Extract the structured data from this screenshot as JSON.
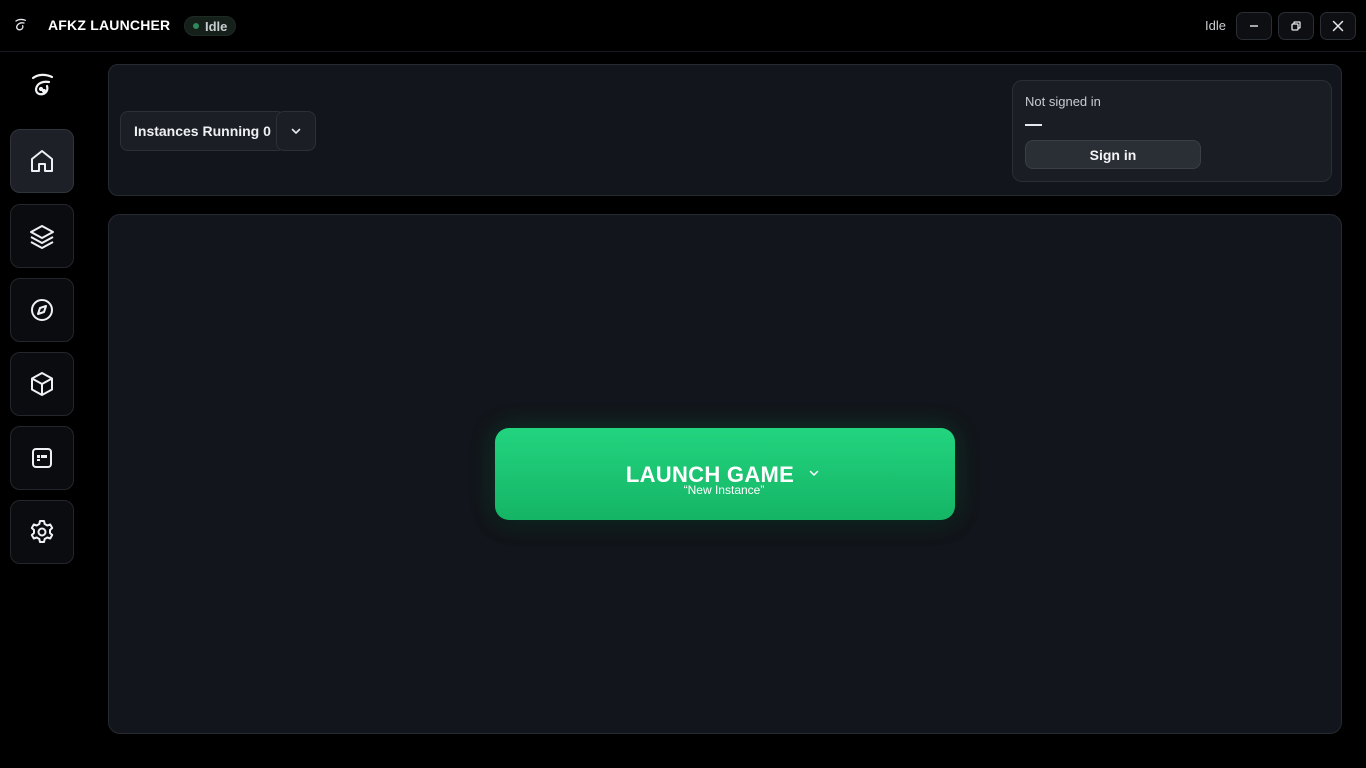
{
  "titlebar": {
    "app_title": "AFKZ LAUNCHER",
    "badge": "Idle",
    "status": "Idle",
    "logo_icon": "afkz-logo-icon",
    "controls": [
      "minimize-icon",
      "restore-icon",
      "close-icon"
    ]
  },
  "sidebar": {
    "logo_icon": "afkz-logo-icon",
    "items": [
      {
        "name": "home",
        "icon": "home-icon",
        "active": true
      },
      {
        "name": "layers",
        "icon": "layers-icon",
        "active": false
      },
      {
        "name": "discover",
        "icon": "compass-icon",
        "active": false
      },
      {
        "name": "packages",
        "icon": "cube-icon",
        "active": false
      },
      {
        "name": "dashboard",
        "icon": "app-window-icon",
        "active": false
      },
      {
        "name": "settings",
        "icon": "gear-icon",
        "active": false
      }
    ]
  },
  "instances": {
    "label": "Instances Running 0"
  },
  "account": {
    "status": "Not signed in",
    "sign_in_label": "Sign in"
  },
  "launch": {
    "title": "LAUNCH GAME",
    "instance": "“New Instance”"
  },
  "colors": {
    "accent": "#1ec474",
    "background": "#000000",
    "panel": "#12151b",
    "badge_dot": "#2c8a5b"
  }
}
